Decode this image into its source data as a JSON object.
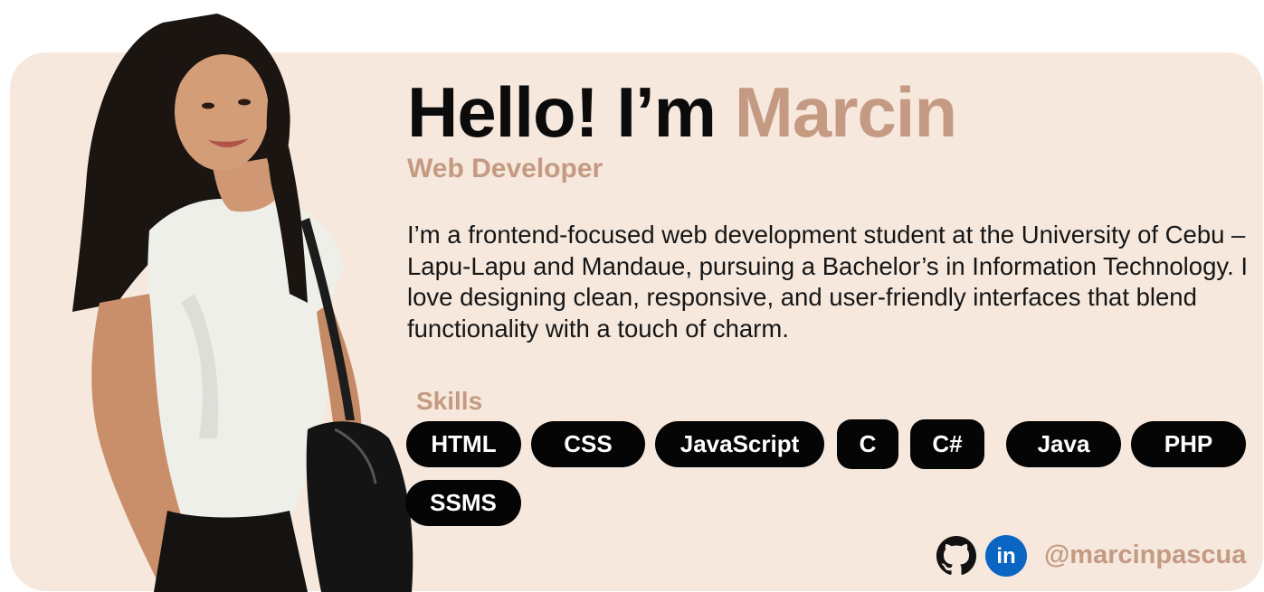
{
  "hero": {
    "greeting": "Hello! I’m ",
    "name": "Marcin",
    "role": "Web Developer",
    "bio": "I’m a frontend-focused web development student at the University of Cebu – Lapu-Lapu and Mandaue, pursuing a Bachelor’s in Information Technology. I love designing clean, responsive, and user-friendly interfaces that blend functionality with a touch of charm."
  },
  "skills": {
    "title": "Skills",
    "items": [
      "HTML",
      "CSS",
      "JavaScript",
      "C",
      "C#",
      "Java",
      "PHP",
      "SSMS"
    ]
  },
  "social": {
    "github_icon": "github-icon",
    "linkedin_icon": "linkedin-icon",
    "linkedin_glyph": "in",
    "handle": "@marcinpascua"
  },
  "colors": {
    "card_bg": "#f6e8dd",
    "accent": "#c49a82",
    "pill_bg": "#050505",
    "linkedin_blue": "#0a66c2"
  }
}
